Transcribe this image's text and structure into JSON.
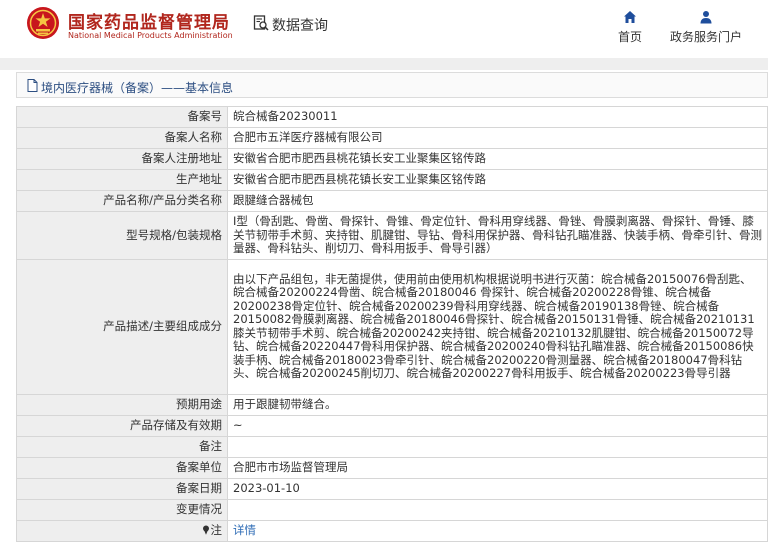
{
  "header": {
    "logo_text_cn": "国家药品监督管理局",
    "logo_text_en": "National Medical Products Administration",
    "query_label": "数据查询",
    "nav": [
      {
        "label": "首页",
        "icon": "home-icon"
      },
      {
        "label": "政务服务门户",
        "icon": "user-icon"
      }
    ]
  },
  "breadcrumb": {
    "text": "境内医疗器械（备案）——基本信息"
  },
  "record": {
    "fields": [
      {
        "label": "备案号",
        "value": "皖合械备20230011"
      },
      {
        "label": "备案人名称",
        "value": "合肥市五洋医疗器械有限公司"
      },
      {
        "label": "备案人注册地址",
        "value": "安徽省合肥市肥西县桃花镇长安工业聚集区铭传路"
      },
      {
        "label": "生产地址",
        "value": "安徽省合肥市肥西县桃花镇长安工业聚集区铭传路"
      },
      {
        "label": "产品名称/产品分类名称",
        "value": "跟腱缝合器械包"
      },
      {
        "label": "型号规格/包装规格",
        "value": "I型（骨刮匙、骨凿、骨探针、骨锥、骨定位针、骨科用穿线器、骨锉、骨膜剥离器、骨探针、骨锤、膝关节韧带手术剪、夹持钳、肌腱钳、导钻、骨科用保护器、骨科钻孔瞄准器、快装手柄、骨牵引针、骨测量器、骨科钻头、削切刀、骨科用扳手、骨导引器）"
      },
      {
        "label": "产品描述/主要组成成分",
        "value": "由以下产品组包，非无菌提供，使用前由使用机构根据说明书进行灭菌：皖合械备20150076骨刮匙、皖合械备20200224骨凿、皖合械备20180046 骨探针、皖合械备20200228骨锥、皖合械备20200238骨定位针、皖合械备20200239骨科用穿线器、皖合械备20190138骨锉、皖合械备20150082骨膜剥离器、皖合械备20180046骨探针、皖合械备20150131骨锤、皖合械备20210131膝关节韧带手术剪、皖合械备20200242夹持钳、皖合械备20210132肌腱钳、皖合械备20150072导钻、皖合械备20220447骨科用保护器、皖合械备20200240骨科钻孔瞄准器、皖合械备20150086快装手柄、皖合械备20180023骨牵引针、皖合械备20200220骨测量器、皖合械备20180047骨科钻头、皖合械备20200245削切刀、皖合械备20200227骨科用扳手、皖合械备20200223骨导引器"
      },
      {
        "label": "预期用途",
        "value": "用于跟腱韧带缝合。"
      },
      {
        "label": "产品存储及有效期",
        "value": "~"
      },
      {
        "label": "备注",
        "value": ""
      },
      {
        "label": "备案单位",
        "value": "合肥市市场监督管理局"
      },
      {
        "label": "备案日期",
        "value": "2023-01-10"
      },
      {
        "label": "变更情况",
        "value": ""
      }
    ],
    "note_row": {
      "label": "注",
      "icon": "pin-icon",
      "link_text": "详情"
    }
  },
  "colors": {
    "brand_red": "#b1261d",
    "nav_blue": "#1f4e9c",
    "link_blue": "#2d6bb5",
    "label_bg": "#eeeeee",
    "border": "#d6d6d6"
  }
}
